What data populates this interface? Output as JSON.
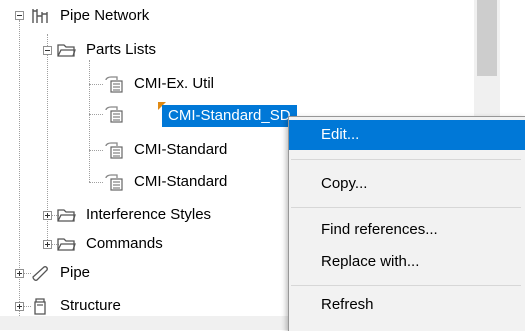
{
  "tree": {
    "pipe_network": "Pipe Network",
    "parts_lists": "Parts Lists",
    "items": [
      "CMI-Ex. Util",
      "CMI-Standard_SD",
      "CMI-Standard",
      "CMI-Standard"
    ],
    "interference_styles": "Interference Styles",
    "commands": "Commands",
    "pipe": "Pipe",
    "structure": "Structure"
  },
  "context_menu": {
    "edit": "Edit...",
    "copy": "Copy...",
    "find_references": "Find references...",
    "replace_with": "Replace with...",
    "refresh": "Refresh"
  },
  "icons": {
    "network": "pipe-network-icon",
    "folder": "folder-icon",
    "parts_list": "parts-list-icon",
    "pipe": "pipe-icon",
    "structure": "structure-icon"
  },
  "colors": {
    "selection": "#0078d7",
    "flag": "#e08a14"
  }
}
